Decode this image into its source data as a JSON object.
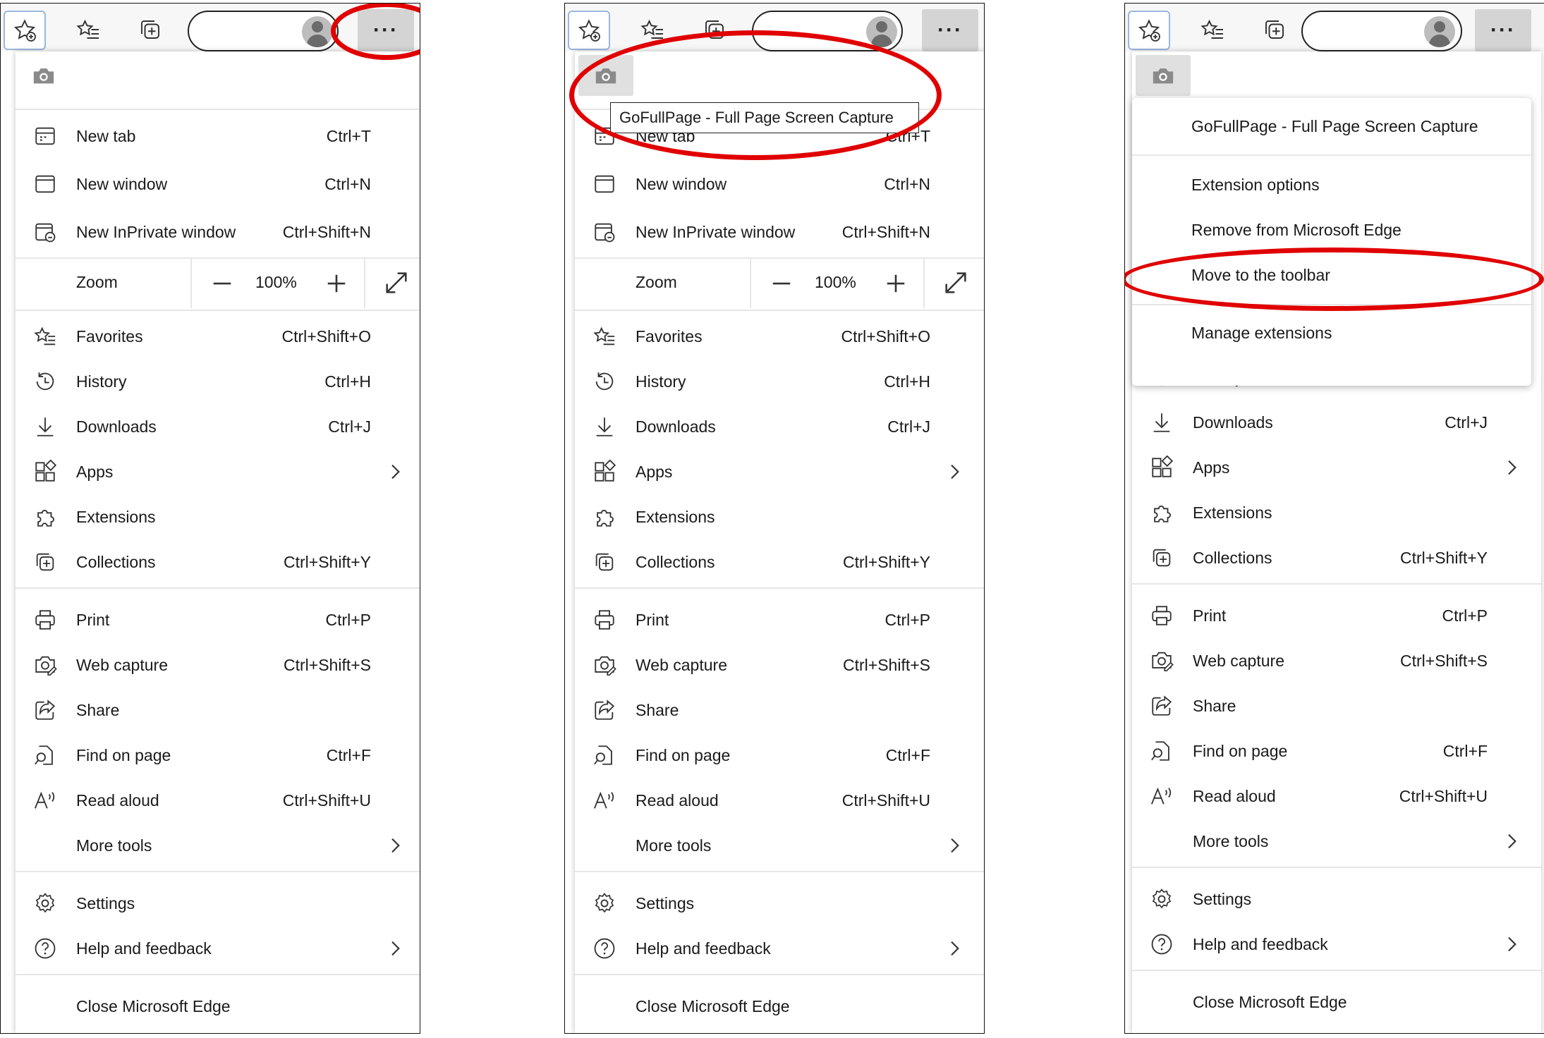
{
  "toolbar": {
    "more_label": "···"
  },
  "menu": {
    "new_tab": {
      "label": "New tab",
      "shortcut": "Ctrl+T"
    },
    "new_window": {
      "label": "New window",
      "shortcut": "Ctrl+N"
    },
    "new_inprivate": {
      "label": "New InPrivate window",
      "shortcut": "Ctrl+Shift+N"
    },
    "zoom": {
      "label": "Zoom",
      "minus": "—",
      "value": "100%",
      "plus": "+"
    },
    "favorites": {
      "label": "Favorites",
      "shortcut": "Ctrl+Shift+O"
    },
    "history": {
      "label": "History",
      "shortcut": "Ctrl+H"
    },
    "downloads": {
      "label": "Downloads",
      "shortcut": "Ctrl+J"
    },
    "apps": {
      "label": "Apps"
    },
    "extensions": {
      "label": "Extensions"
    },
    "collections": {
      "label": "Collections",
      "shortcut": "Ctrl+Shift+Y"
    },
    "print": {
      "label": "Print",
      "shortcut": "Ctrl+P"
    },
    "web_capture": {
      "label": "Web capture",
      "shortcut": "Ctrl+Shift+S"
    },
    "share": {
      "label": "Share"
    },
    "find": {
      "label": "Find on page",
      "shortcut": "Ctrl+F"
    },
    "read_aloud": {
      "label": "Read aloud",
      "shortcut": "Ctrl+Shift+U"
    },
    "more_tools": {
      "label": "More tools"
    },
    "settings": {
      "label": "Settings"
    },
    "help": {
      "label": "Help and feedback"
    },
    "close": {
      "label": "Close Microsoft Edge"
    }
  },
  "tooltip": {
    "text": "GoFullPage - Full Page Screen Capture"
  },
  "context_menu": {
    "title": "GoFullPage - Full Page Screen Capture",
    "extension_options": "Extension options",
    "remove": "Remove from Microsoft Edge",
    "move_to_toolbar": "Move to the toolbar",
    "manage": "Manage extensions"
  },
  "colors": {
    "highlight": "#e00000",
    "toolbar_bg": "#f7f7f7",
    "active_bg": "#d4d4d4"
  }
}
